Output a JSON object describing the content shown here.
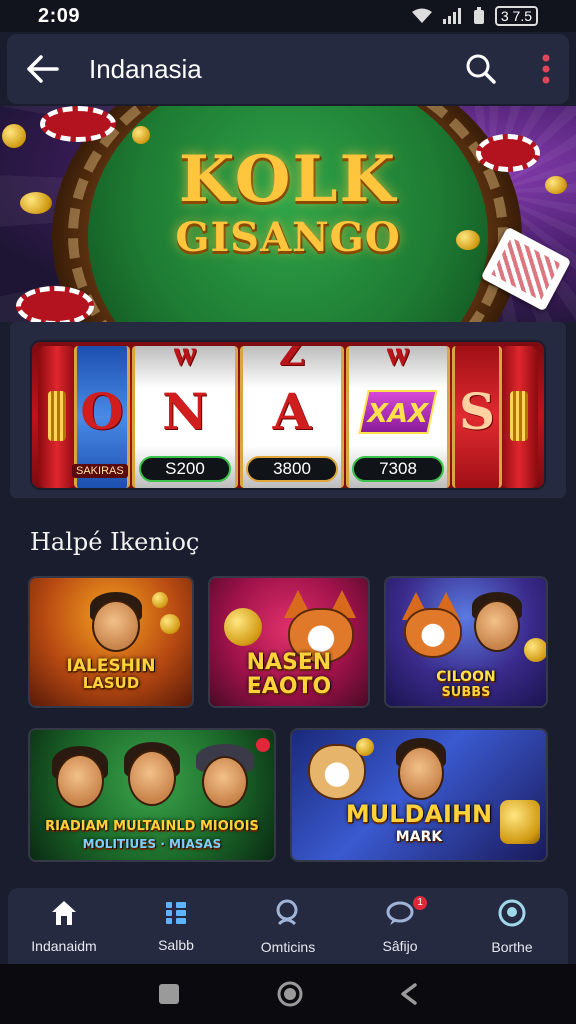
{
  "status_bar": {
    "time": "2:09",
    "battery": "3 7.5"
  },
  "app_bar": {
    "title": "Indanasia",
    "icons": [
      "back-arrow-icon",
      "search-icon",
      "more-vert-icon"
    ]
  },
  "hero": {
    "logo_line1": "KOLK",
    "logo_line2": "GISANGO"
  },
  "slot_machine": {
    "reels": [
      {
        "symbol_top": "",
        "symbol_mid": "O",
        "value": ""
      },
      {
        "symbol_top": "ѡ",
        "symbol_mid": "N",
        "value": "S200"
      },
      {
        "symbol_top": "Z",
        "symbol_mid": "A",
        "value": "3800"
      },
      {
        "symbol_top": "ѡ",
        "symbol_mid": "XAX",
        "value": "7308"
      },
      {
        "symbol_top": "",
        "symbol_mid": "S",
        "value": ""
      }
    ],
    "tag": "SAKIRAS"
  },
  "section": {
    "title": "Halpé Ikenioç"
  },
  "games": [
    {
      "title_line1": "IALESHIN",
      "title_line2": "LASUD"
    },
    {
      "title_line1": "NASEN",
      "title_line2": "EAOTO"
    },
    {
      "title_line1": "CILOON",
      "title_line2": "SUBBS"
    },
    {
      "title_line1": "RIADIAM MULTAINLD MIOIOIS",
      "title_line2": "MOLITIUES · MIASAS"
    },
    {
      "title_line1": "MULDAIHN",
      "title_line2": "MARK"
    }
  ],
  "bottom_nav": [
    {
      "label": "Indanaidm",
      "icon": "home-icon"
    },
    {
      "label": "Salbb",
      "icon": "grid-list-icon"
    },
    {
      "label": "Omticins",
      "icon": "search-icon"
    },
    {
      "label": "Sâfijo",
      "icon": "chat-icon",
      "badge": "1"
    },
    {
      "label": "Borthe",
      "icon": "profile-icon"
    }
  ],
  "colors": {
    "background": "#1a1d2e",
    "panel": "#252a40",
    "accent_gold": "#ffc53d",
    "accent_red": "#c0121b"
  }
}
